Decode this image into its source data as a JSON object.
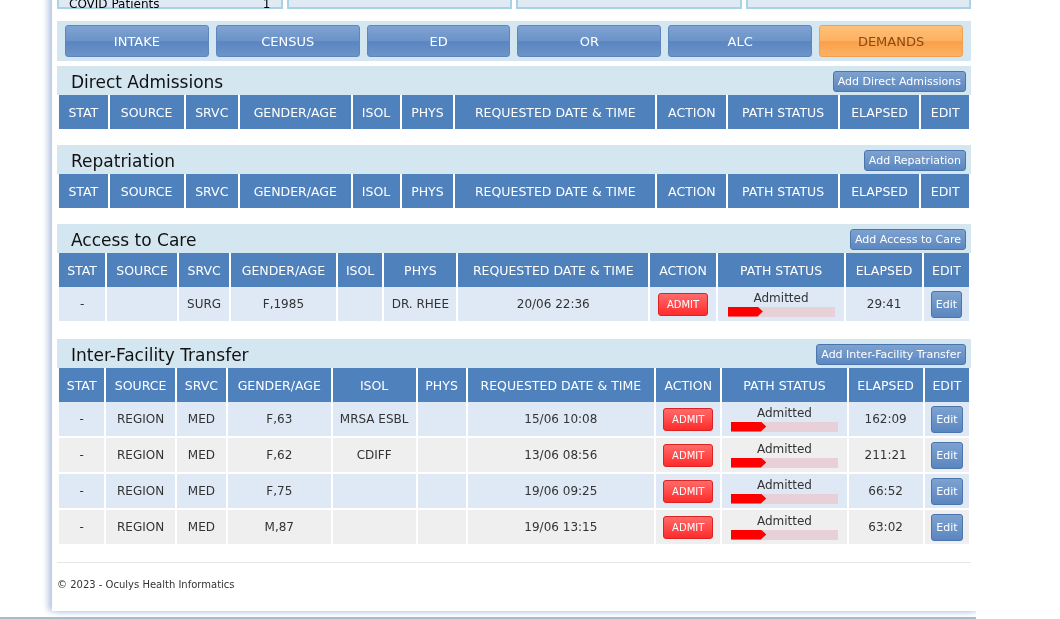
{
  "summary_cards": [
    {
      "label": "COVID Patients",
      "value": "1"
    }
  ],
  "tabs": [
    {
      "label": "INTAKE",
      "selected": false
    },
    {
      "label": "CENSUS",
      "selected": false
    },
    {
      "label": "ED",
      "selected": false
    },
    {
      "label": "OR",
      "selected": false
    },
    {
      "label": "ALC",
      "selected": false
    },
    {
      "label": "DEMANDS",
      "selected": true
    }
  ],
  "sections": [
    {
      "title": "Direct Admissions",
      "add_button": "Add Direct Admissions",
      "columns": [
        "STAT",
        "SOURCE",
        "SRVC",
        "GENDER/AGE",
        "ISOL",
        "PHYS",
        "REQUESTED DATE & TIME",
        "ACTION",
        "PATH STATUS",
        "ELAPSED",
        "EDIT"
      ]
    },
    {
      "title": "Repatriation",
      "add_button": "Add Repatriation",
      "columns": [
        "STAT",
        "SOURCE",
        "SRVC",
        "GENDER/AGE",
        "ISOL",
        "PHYS",
        "REQUESTED DATE & TIME",
        "ACTION",
        "PATH STATUS",
        "ELAPSED",
        "EDIT"
      ]
    },
    {
      "title": "Access to Care",
      "add_button": "Add Access to Care",
      "columns": [
        "STAT",
        "SOURCE",
        "SRVC",
        "GENDER/AGE",
        "ISOL",
        "PHYS",
        "REQUESTED DATE & TIME",
        "ACTION",
        "PATH STATUS",
        "ELAPSED",
        "EDIT"
      ],
      "rows": [
        {
          "stat": "-",
          "source": "",
          "srvc": "SURG",
          "gender_age": "F,1985",
          "isol": "",
          "phys": "DR. RHEE",
          "requested": "20/06 22:36",
          "action": "ADMIT",
          "path_status": "Admitted",
          "level": 0.33,
          "elapsed": "29:41",
          "edit": "Edit"
        }
      ]
    },
    {
      "title": "Inter-Facility Transfer",
      "add_button": "Add Inter-Facility Transfer",
      "columns": [
        "STAT",
        "SOURCE",
        "SRVC",
        "GENDER/AGE",
        "ISOL",
        "PHYS",
        "REQUESTED DATE & TIME",
        "ACTION",
        "PATH STATUS",
        "ELAPSED",
        "EDIT"
      ],
      "rows": [
        {
          "stat": "-",
          "source": "REGION",
          "srvc": "MED",
          "gender_age": "F,63",
          "isol": "MRSA ESBL",
          "phys": "",
          "requested": "15/06 10:08",
          "action": "ADMIT",
          "path_status": "Admitted",
          "level": 0.33,
          "elapsed": "162:09",
          "edit": "Edit"
        },
        {
          "stat": "-",
          "source": "REGION",
          "srvc": "MED",
          "gender_age": "F,62",
          "isol": "CDIFF",
          "phys": "",
          "requested": "13/06 08:56",
          "action": "ADMIT",
          "path_status": "Admitted",
          "level": 0.33,
          "elapsed": "211:21",
          "edit": "Edit"
        },
        {
          "stat": "-",
          "source": "REGION",
          "srvc": "MED",
          "gender_age": "F,75",
          "isol": "",
          "phys": "",
          "requested": "19/06 09:25",
          "action": "ADMIT",
          "path_status": "Admitted",
          "level": 0.33,
          "elapsed": "66:52",
          "edit": "Edit"
        },
        {
          "stat": "-",
          "source": "REGION",
          "srvc": "MED",
          "gender_age": "M,87",
          "isol": "",
          "phys": "",
          "requested": "19/06 13:15",
          "action": "ADMIT",
          "path_status": "Admitted",
          "level": 0.33,
          "elapsed": "63:02",
          "edit": "Edit"
        }
      ]
    }
  ],
  "footer": "© 2023 - Oculys Health Informatics"
}
